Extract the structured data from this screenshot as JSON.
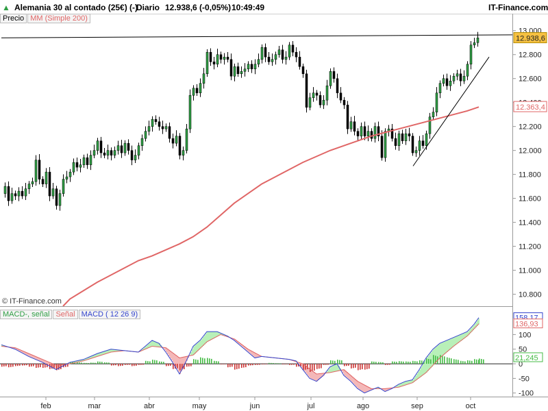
{
  "header": {
    "instrument": "Alemania 30 al contado (25€) (-)",
    "period": "Diario",
    "quote": "12.938,6 (-0,05%)",
    "time": "10:49:49",
    "brand": "IT-Finance.com"
  },
  "legend_top": {
    "price": "Precio",
    "ma": "MM (Simple 200)"
  },
  "legend_macd": {
    "hist": "MACD-, señal",
    "signal": "Señal",
    "macd": "MACD ( 12 26 9)"
  },
  "watermark": "© IT-Finance.com",
  "colors": {
    "up": "#2f9e44",
    "down": "#000000",
    "ma": "#e06666",
    "macd": "#3344cc",
    "signal": "#e06666",
    "hist_pos": "#44bb44",
    "hist_neg": "#cc3333",
    "fill_pos": "#b8f0b8",
    "fill_neg": "#f4b8b8",
    "current": "#f6c142"
  },
  "chart_data": [
    {
      "type": "candlestick",
      "title": "Alemania 30 al contado (25€) (-)",
      "x_ticks": [
        "feb",
        "mar",
        "abr",
        "may",
        "jun",
        "jul",
        "ago",
        "sep",
        "oct"
      ],
      "y_ticks": [
        "10.800",
        "11.000",
        "11.200",
        "11.400",
        "11.600",
        "11.800",
        "12.000",
        "12.200",
        "12.400",
        "12.600",
        "12.800",
        "13.000"
      ],
      "ylim": [
        10700,
        13050
      ],
      "price_path": [
        [
          0,
          11640
        ],
        [
          5,
          11700
        ],
        [
          10,
          11580
        ],
        [
          15,
          11640
        ],
        [
          20,
          11620
        ],
        [
          25,
          11660
        ],
        [
          30,
          11620
        ],
        [
          35,
          11680
        ],
        [
          40,
          11720
        ],
        [
          45,
          11740
        ],
        [
          50,
          11920
        ],
        [
          55,
          11760
        ],
        [
          60,
          11720
        ],
        [
          65,
          11820
        ],
        [
          70,
          11620
        ],
        [
          75,
          11680
        ],
        [
          80,
          11540
        ],
        [
          85,
          11640
        ],
        [
          90,
          11760
        ],
        [
          95,
          11780
        ],
        [
          100,
          11820
        ],
        [
          105,
          11900
        ],
        [
          110,
          11860
        ],
        [
          115,
          11880
        ],
        [
          120,
          11940
        ],
        [
          125,
          11880
        ],
        [
          130,
          11960
        ],
        [
          135,
          12000
        ],
        [
          140,
          12080
        ],
        [
          145,
          11980
        ],
        [
          150,
          11960
        ],
        [
          155,
          12000
        ],
        [
          160,
          11960
        ],
        [
          165,
          12000
        ],
        [
          170,
          12040
        ],
        [
          175,
          11980
        ],
        [
          180,
          12060
        ],
        [
          185,
          12000
        ],
        [
          190,
          11920
        ],
        [
          195,
          11960
        ],
        [
          200,
          12040
        ],
        [
          205,
          12100
        ],
        [
          210,
          12160
        ],
        [
          215,
          12200
        ],
        [
          220,
          12260
        ],
        [
          225,
          12240
        ],
        [
          230,
          12200
        ],
        [
          235,
          12180
        ],
        [
          240,
          12200
        ],
        [
          245,
          12100
        ],
        [
          250,
          12060
        ],
        [
          255,
          12120
        ],
        [
          260,
          11960
        ],
        [
          265,
          12000
        ],
        [
          270,
          12180
        ],
        [
          275,
          12460
        ],
        [
          280,
          12520
        ],
        [
          285,
          12480
        ],
        [
          290,
          12560
        ],
        [
          295,
          12640
        ],
        [
          300,
          12820
        ],
        [
          305,
          12740
        ],
        [
          310,
          12720
        ],
        [
          315,
          12800
        ],
        [
          320,
          12760
        ],
        [
          325,
          12780
        ],
        [
          330,
          12760
        ],
        [
          335,
          12620
        ],
        [
          340,
          12700
        ],
        [
          345,
          12640
        ],
        [
          350,
          12660
        ],
        [
          355,
          12680
        ],
        [
          360,
          12720
        ],
        [
          365,
          12680
        ],
        [
          370,
          12720
        ],
        [
          375,
          12760
        ],
        [
          380,
          12860
        ],
        [
          385,
          12780
        ],
        [
          390,
          12740
        ],
        [
          395,
          12760
        ],
        [
          400,
          12800
        ],
        [
          405,
          12840
        ],
        [
          410,
          12760
        ],
        [
          415,
          12780
        ],
        [
          420,
          12880
        ],
        [
          425,
          12820
        ],
        [
          430,
          12780
        ],
        [
          435,
          12700
        ],
        [
          440,
          12640
        ],
        [
          445,
          12360
        ],
        [
          450,
          12440
        ],
        [
          455,
          12480
        ],
        [
          460,
          12460
        ],
        [
          465,
          12380
        ],
        [
          470,
          12420
        ],
        [
          475,
          12540
        ],
        [
          480,
          12660
        ],
        [
          485,
          12600
        ],
        [
          490,
          12480
        ],
        [
          495,
          12420
        ],
        [
          500,
          12380
        ],
        [
          505,
          12180
        ],
        [
          510,
          12240
        ],
        [
          515,
          12160
        ],
        [
          520,
          12120
        ],
        [
          525,
          12200
        ],
        [
          530,
          12120
        ],
        [
          535,
          12160
        ],
        [
          540,
          12100
        ],
        [
          545,
          12200
        ],
        [
          550,
          12120
        ],
        [
          555,
          11940
        ],
        [
          560,
          12160
        ],
        [
          565,
          12180
        ],
        [
          570,
          12100
        ],
        [
          575,
          12040
        ],
        [
          580,
          12140
        ],
        [
          585,
          12080
        ],
        [
          590,
          12140
        ],
        [
          595,
          12120
        ],
        [
          600,
          11980
        ],
        [
          605,
          12000
        ],
        [
          610,
          12080
        ],
        [
          615,
          12040
        ],
        [
          620,
          12140
        ],
        [
          625,
          12280
        ],
        [
          630,
          12320
        ],
        [
          635,
          12480
        ],
        [
          640,
          12560
        ],
        [
          645,
          12600
        ],
        [
          650,
          12540
        ],
        [
          655,
          12580
        ],
        [
          660,
          12620
        ],
        [
          665,
          12640
        ],
        [
          670,
          12580
        ],
        [
          675,
          12620
        ],
        [
          680,
          12720
        ],
        [
          685,
          12880
        ],
        [
          690,
          12900
        ],
        [
          695,
          12940
        ]
      ],
      "series": [
        {
          "name": "MM (Simple 200)",
          "values": [
            [
              90,
              10700
            ],
            [
              100,
              10760
            ],
            [
              120,
              10830
            ],
            [
              140,
              10900
            ],
            [
              160,
              10960
            ],
            [
              180,
              11020
            ],
            [
              200,
              11080
            ],
            [
              220,
              11120
            ],
            [
              240,
              11170
            ],
            [
              260,
              11220
            ],
            [
              280,
              11280
            ],
            [
              300,
              11360
            ],
            [
              320,
              11460
            ],
            [
              340,
              11560
            ],
            [
              360,
              11640
            ],
            [
              380,
              11720
            ],
            [
              400,
              11780
            ],
            [
              420,
              11840
            ],
            [
              440,
              11900
            ],
            [
              460,
              11950
            ],
            [
              480,
              12000
            ],
            [
              500,
              12040
            ],
            [
              520,
              12080
            ],
            [
              540,
              12120
            ],
            [
              560,
              12150
            ],
            [
              580,
              12180
            ],
            [
              600,
              12210
            ],
            [
              620,
              12240
            ],
            [
              640,
              12270
            ],
            [
              660,
              12300
            ],
            [
              680,
              12330
            ],
            [
              697,
              12363
            ]
          ]
        }
      ],
      "current_price": "12.938,6",
      "ma_value": "12.363,4",
      "resistance_line": [
        [
          0,
          12940
        ],
        [
          748,
          12965
        ]
      ],
      "support_line": [
        [
          603,
          11870
        ],
        [
          714,
          12780
        ]
      ]
    },
    {
      "type": "macd",
      "title": "MACD ( 12 26 9)",
      "y_ticks": [
        "100",
        "50",
        "0",
        "-50",
        "-100"
      ],
      "ylim": [
        -110,
        190
      ],
      "values_labels": [
        "158,17",
        "136,93",
        "21,245"
      ],
      "macd": [
        [
          0,
          65
        ],
        [
          20,
          50
        ],
        [
          40,
          25
        ],
        [
          60,
          5
        ],
        [
          80,
          -20
        ],
        [
          100,
          5
        ],
        [
          120,
          15
        ],
        [
          140,
          35
        ],
        [
          160,
          50
        ],
        [
          180,
          45
        ],
        [
          200,
          40
        ],
        [
          210,
          60
        ],
        [
          220,
          80
        ],
        [
          230,
          70
        ],
        [
          240,
          40
        ],
        [
          250,
          5
        ],
        [
          260,
          -35
        ],
        [
          270,
          10
        ],
        [
          280,
          60
        ],
        [
          290,
          80
        ],
        [
          300,
          110
        ],
        [
          315,
          110
        ],
        [
          330,
          95
        ],
        [
          340,
          80
        ],
        [
          350,
          60
        ],
        [
          360,
          40
        ],
        [
          370,
          20
        ],
        [
          380,
          25
        ],
        [
          400,
          20
        ],
        [
          420,
          15
        ],
        [
          430,
          10
        ],
        [
          440,
          -20
        ],
        [
          450,
          -50
        ],
        [
          460,
          -60
        ],
        [
          470,
          -40
        ],
        [
          480,
          -10
        ],
        [
          490,
          0
        ],
        [
          500,
          -40
        ],
        [
          510,
          -60
        ],
        [
          520,
          -85
        ],
        [
          530,
          -100
        ],
        [
          540,
          -90
        ],
        [
          550,
          -80
        ],
        [
          560,
          -95
        ],
        [
          570,
          -85
        ],
        [
          580,
          -70
        ],
        [
          590,
          -60
        ],
        [
          600,
          -55
        ],
        [
          610,
          -20
        ],
        [
          620,
          20
        ],
        [
          630,
          50
        ],
        [
          640,
          70
        ],
        [
          650,
          80
        ],
        [
          660,
          90
        ],
        [
          670,
          100
        ],
        [
          680,
          110
        ],
        [
          690,
          135
        ],
        [
          697,
          158
        ]
      ],
      "signal": [
        [
          0,
          60
        ],
        [
          20,
          55
        ],
        [
          40,
          35
        ],
        [
          60,
          15
        ],
        [
          80,
          -5
        ],
        [
          100,
          0
        ],
        [
          120,
          10
        ],
        [
          140,
          25
        ],
        [
          160,
          40
        ],
        [
          180,
          45
        ],
        [
          200,
          40
        ],
        [
          220,
          60
        ],
        [
          240,
          55
        ],
        [
          260,
          20
        ],
        [
          280,
          30
        ],
        [
          300,
          75
        ],
        [
          320,
          100
        ],
        [
          340,
          85
        ],
        [
          360,
          50
        ],
        [
          380,
          25
        ],
        [
          400,
          20
        ],
        [
          420,
          15
        ],
        [
          440,
          0
        ],
        [
          460,
          -35
        ],
        [
          480,
          -30
        ],
        [
          500,
          -20
        ],
        [
          520,
          -60
        ],
        [
          540,
          -85
        ],
        [
          560,
          -85
        ],
        [
          580,
          -80
        ],
        [
          600,
          -65
        ],
        [
          620,
          -30
        ],
        [
          640,
          20
        ],
        [
          660,
          60
        ],
        [
          680,
          95
        ],
        [
          697,
          137
        ]
      ],
      "histogram": [
        [
          0,
          -10
        ],
        [
          10,
          -12
        ],
        [
          20,
          -8
        ],
        [
          30,
          -6
        ],
        [
          40,
          -10
        ],
        [
          50,
          -14
        ],
        [
          60,
          -14
        ],
        [
          70,
          -18
        ],
        [
          80,
          -22
        ],
        [
          90,
          -12
        ],
        [
          100,
          6
        ],
        [
          110,
          5
        ],
        [
          120,
          3
        ],
        [
          130,
          4
        ],
        [
          140,
          8
        ],
        [
          150,
          5
        ],
        [
          160,
          -6
        ],
        [
          170,
          -8
        ],
        [
          180,
          -4
        ],
        [
          190,
          -8
        ],
        [
          200,
          -4
        ],
        [
          210,
          10
        ],
        [
          220,
          14
        ],
        [
          230,
          8
        ],
        [
          240,
          -8
        ],
        [
          250,
          -18
        ],
        [
          260,
          -22
        ],
        [
          270,
          -10
        ],
        [
          280,
          16
        ],
        [
          290,
          22
        ],
        [
          300,
          20
        ],
        [
          310,
          10
        ],
        [
          320,
          -2
        ],
        [
          330,
          -12
        ],
        [
          340,
          -20
        ],
        [
          350,
          -14
        ],
        [
          360,
          -6
        ],
        [
          370,
          -4
        ],
        [
          380,
          -2
        ],
        [
          390,
          3
        ],
        [
          400,
          2
        ],
        [
          410,
          -2
        ],
        [
          420,
          -4
        ],
        [
          430,
          -10
        ],
        [
          440,
          -22
        ],
        [
          450,
          -28
        ],
        [
          460,
          -18
        ],
        [
          470,
          -4
        ],
        [
          480,
          12
        ],
        [
          490,
          14
        ],
        [
          500,
          -8
        ],
        [
          510,
          -16
        ],
        [
          520,
          -22
        ],
        [
          530,
          -20
        ],
        [
          540,
          8
        ],
        [
          550,
          6
        ],
        [
          560,
          -4
        ],
        [
          570,
          8
        ],
        [
          580,
          9
        ],
        [
          590,
          8
        ],
        [
          600,
          10
        ],
        [
          610,
          12
        ],
        [
          620,
          18
        ],
        [
          630,
          30
        ],
        [
          640,
          30
        ],
        [
          650,
          22
        ],
        [
          660,
          16
        ],
        [
          670,
          10
        ],
        [
          680,
          12
        ],
        [
          690,
          16
        ],
        [
          697,
          18
        ]
      ]
    }
  ]
}
